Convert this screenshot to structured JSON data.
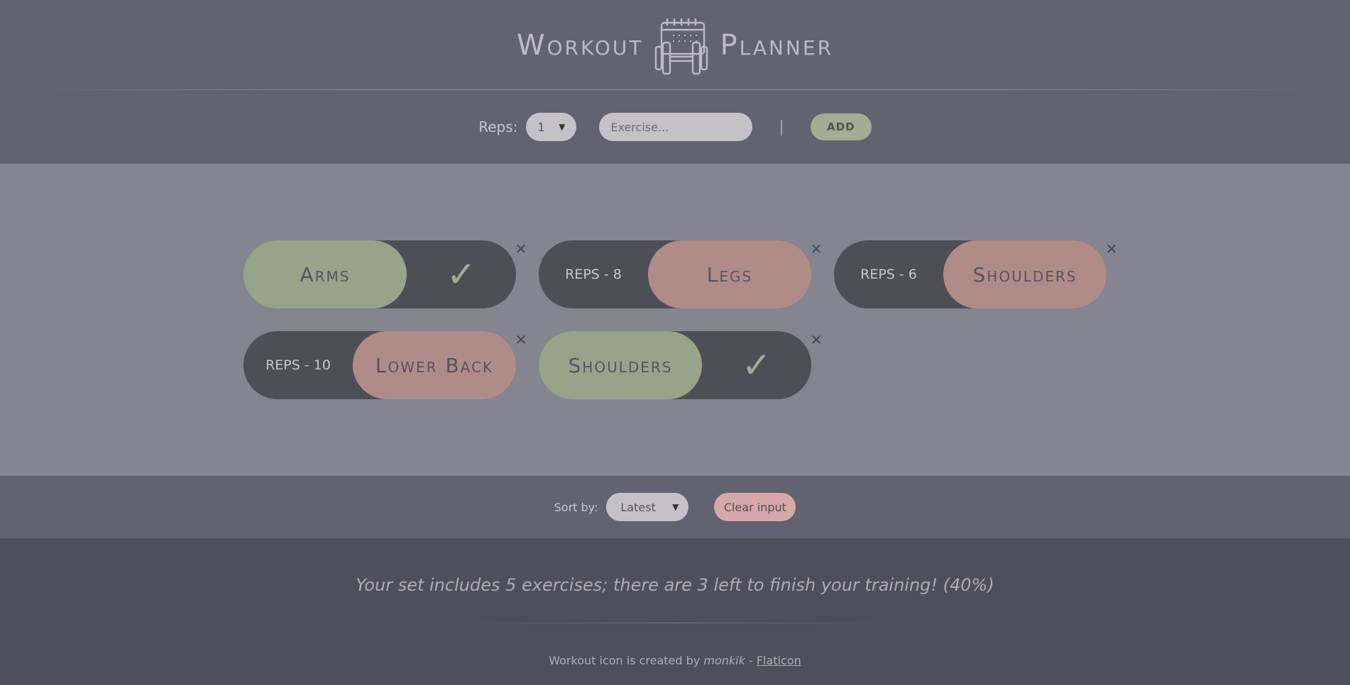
{
  "header": {
    "title_left": "Workout",
    "title_right": "Planner",
    "logo_icon": "workout-calendar-dumbbell-icon"
  },
  "controls": {
    "reps_label": "Reps:",
    "reps_value": "1",
    "exercise_placeholder": "Exercise...",
    "separator": "|",
    "add_label": "ADD"
  },
  "exercises": [
    {
      "name": "Arms",
      "done": true,
      "reps": ""
    },
    {
      "name": "Legs",
      "done": false,
      "reps": "REPS - 8"
    },
    {
      "name": "Shoulders",
      "done": false,
      "reps": "REPS - 6"
    },
    {
      "name": "Lower Back",
      "done": false,
      "reps": "REPS - 10"
    },
    {
      "name": "Shoulders",
      "done": true,
      "reps": ""
    }
  ],
  "icons": {
    "check": "✓",
    "close": "✕"
  },
  "sort": {
    "label": "Sort by:",
    "value": "Latest",
    "clear_label": "Clear input"
  },
  "footer": {
    "stats": "Your set includes 5 exercises; there are 3 left to finish your training! (40%)",
    "credit_prefix": "Workout icon is created by",
    "credit_author": "monkik",
    "credit_dash": "-",
    "credit_link": "Flaticon"
  },
  "colors": {
    "header_bg": "#626270",
    "main_bg": "#85858f",
    "card_bg": "#4e4e57",
    "done_green": "#98a489",
    "todo_rose": "#b08c89",
    "clear_btn": "#d6a9a8"
  }
}
